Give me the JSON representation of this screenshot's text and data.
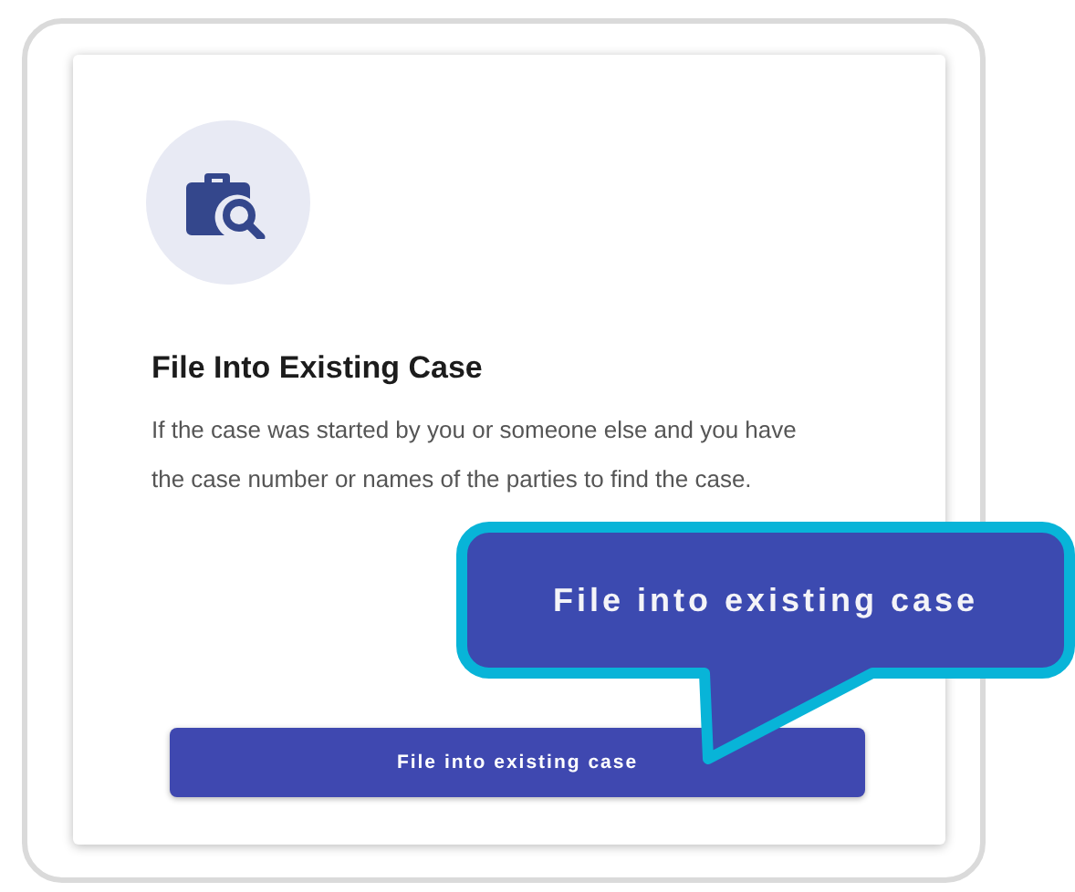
{
  "card": {
    "title": "File Into Existing Case",
    "description": "If the case was started by you or someone else and you have the case number or names of the parties to find the case.",
    "button": "File into existing case"
  },
  "callout": {
    "text": "File into existing case"
  }
}
